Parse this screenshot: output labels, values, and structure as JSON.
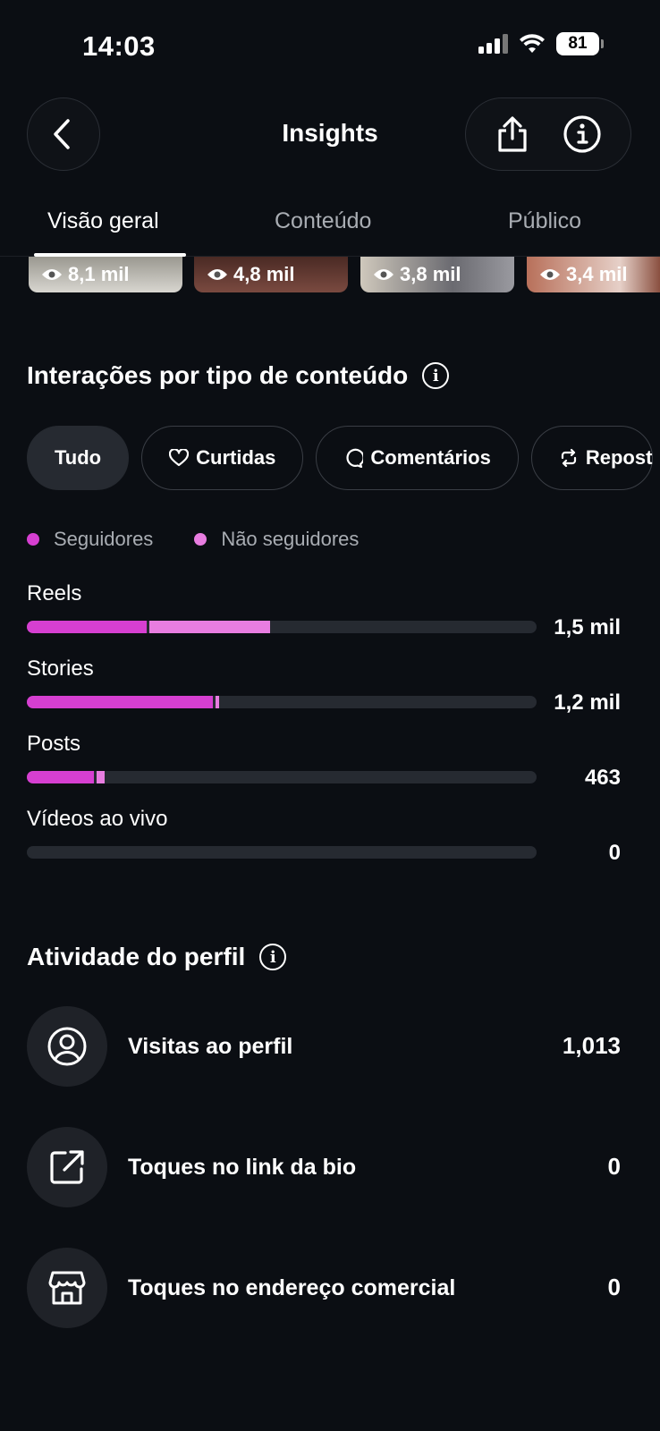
{
  "status_bar": {
    "time": "14:03",
    "battery": "81"
  },
  "header": {
    "title": "Insights"
  },
  "tabs": [
    {
      "label": "Visão geral",
      "active": true
    },
    {
      "label": "Conteúdo",
      "active": false
    },
    {
      "label": "Público",
      "active": false
    }
  ],
  "thumbnails": [
    {
      "views": "8,1 mil"
    },
    {
      "views": "4,8 mil"
    },
    {
      "views": "3,8 mil"
    },
    {
      "views": "3,4 mil"
    }
  ],
  "interactions": {
    "title": "Interações por tipo de conteúdo",
    "filters": [
      {
        "label": "Tudo",
        "icon": "",
        "selected": true
      },
      {
        "label": "Curtidas",
        "icon": "heart-icon",
        "selected": false
      },
      {
        "label": "Comentários",
        "icon": "comment-icon",
        "selected": false
      },
      {
        "label": "Repost",
        "icon": "repost-icon",
        "selected": false
      }
    ],
    "legend": [
      {
        "label": "Seguidores",
        "color": "#d63fd1"
      },
      {
        "label": "Não seguidores",
        "color": "#e87de0"
      }
    ],
    "colors": {
      "followers": "#d63fd1",
      "non_followers": "#e87de0",
      "track": "#262a31"
    },
    "rows": [
      {
        "label": "Reels",
        "value": "1,5 mil",
        "followers_pct": 23.5,
        "non_followers_pct": 24.3
      },
      {
        "label": "Stories",
        "value": "1,2 mil",
        "followers_pct": 36.5,
        "non_followers_pct": 1.3
      },
      {
        "label": "Posts",
        "value": "463",
        "followers_pct": 13.2,
        "non_followers_pct": 2.0
      },
      {
        "label": "Vídeos ao vivo",
        "value": "0",
        "followers_pct": 0,
        "non_followers_pct": 0
      }
    ]
  },
  "profile_activity": {
    "title": "Atividade do perfil",
    "rows": [
      {
        "label": "Visitas ao perfil",
        "value": "1,013",
        "icon": "user-circle-icon"
      },
      {
        "label": "Toques no link da bio",
        "value": "0",
        "icon": "external-link-icon"
      },
      {
        "label": "Toques no endereço comercial",
        "value": "0",
        "icon": "storefront-icon"
      }
    ]
  }
}
